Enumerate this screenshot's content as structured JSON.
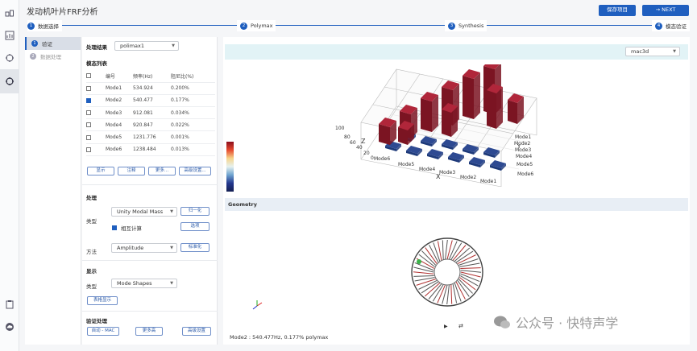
{
  "app": {
    "title": "发动机叶片FRF分析"
  },
  "header": {
    "save_label": "保存项目",
    "next_label": "NEXT",
    "next_arrow": "→"
  },
  "steps": [
    {
      "num": "1",
      "label": "数据选择"
    },
    {
      "num": "2",
      "label": "Polymax"
    },
    {
      "num": "3",
      "label": "Synthesis"
    },
    {
      "num": "4",
      "label": "模态验证"
    }
  ],
  "nav": [
    {
      "num": "1",
      "label": "验证"
    },
    {
      "num": "2",
      "label": "数据处理"
    }
  ],
  "panel": {
    "result_label": "处理结果",
    "result_value": "polimax1",
    "list_title": "模态列表",
    "columns": [
      "编号",
      "频率(Hz)",
      "阻尼比(%)"
    ],
    "rows": [
      {
        "checked": false,
        "id": "Mode1",
        "freq": "534.924",
        "damp": "0.200%"
      },
      {
        "checked": true,
        "id": "Mode2",
        "freq": "540.477",
        "damp": "0.177%"
      },
      {
        "checked": false,
        "id": "Mode3",
        "freq": "912.081",
        "damp": "0.034%"
      },
      {
        "checked": false,
        "id": "Mode4",
        "freq": "920.847",
        "damp": "0.022%"
      },
      {
        "checked": false,
        "id": "Mode5",
        "freq": "1231.776",
        "damp": "0.001%"
      },
      {
        "checked": false,
        "id": "Mode6",
        "freq": "1238.484",
        "damp": "0.013%"
      }
    ],
    "list_buttons": [
      "显示",
      "注释",
      "更多...",
      "高级设置..."
    ],
    "process_title": "处理",
    "type_label": "类型",
    "type_value": "Unity Modal Mass",
    "normalize_label": "归一化",
    "reciprocal_label": "相互计算",
    "options_label": "选项",
    "method_label": "方法",
    "method_value": "Amplitude",
    "standardize_label": "标准化",
    "display_title": "显示",
    "display_type_label": "类型",
    "display_type_value": "Mode Shapes",
    "table_display_label": "表格显示",
    "verify_title": "验证处理",
    "verify_buttons": [
      "自动 - MAC",
      "更多高",
      "高级设置"
    ]
  },
  "chart_panel": {
    "select_value": "mac3d",
    "x_axis": "X",
    "z_axis": "Z",
    "z_ticks": [
      "100",
      "80",
      "60",
      "40",
      "20",
      "0"
    ],
    "x_modes": [
      "Mode6",
      "Mode5",
      "Mode4",
      "Mode3",
      "Mode2",
      "Mode1"
    ],
    "y_modes": [
      "Mode1",
      "Mode2",
      "Mode3",
      "Mode4",
      "Mode5",
      "Mode6"
    ],
    "y_suffix": "Y"
  },
  "geometry": {
    "title": "Geometry",
    "status": "Mode2 : 540.477Hz, 0.177% polymax",
    "play_icon": "▶",
    "loop_icon": "⇄"
  },
  "watermark": {
    "text": "公众号 · 快特声学"
  },
  "colors": {
    "accent": "#1f5fbf",
    "bar_top": "#a01b2c",
    "bar_side": "#7b1422",
    "blue_bar": "#1e3a7a",
    "header_bg": "#e2f3f6"
  }
}
